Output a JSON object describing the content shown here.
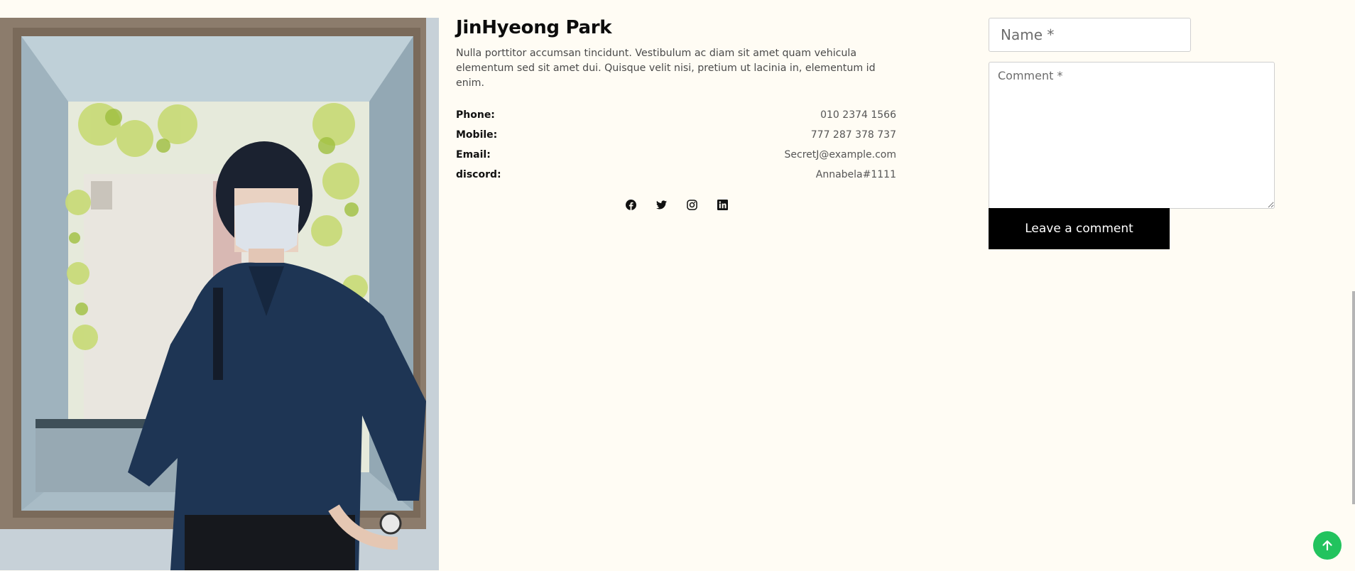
{
  "profile": {
    "name": "JinHyeong Park",
    "bio": "Nulla porttitor accumsan tincidunt. Vestibulum ac diam sit amet quam vehicula elementum sed sit amet dui. Quisque velit nisi, pretium ut lacinia in, elementum id enim.",
    "contacts": [
      {
        "label": "Phone:",
        "value": "010 2374 1566"
      },
      {
        "label": "Mobile:",
        "value": "777 287 378 737"
      },
      {
        "label": "Email:",
        "value": "SecretJ@example.com"
      },
      {
        "label": "discord:",
        "value": "Annabela#1111"
      }
    ],
    "socials": [
      "facebook-icon",
      "twitter-icon",
      "instagram-icon",
      "linkedin-icon"
    ]
  },
  "form": {
    "name_placeholder": "Name *",
    "comment_placeholder": "Comment *",
    "submit_label": "Leave a comment"
  },
  "colors": {
    "background": "#fffcf4",
    "button": "#000000",
    "scroll_top": "#22c35e"
  }
}
